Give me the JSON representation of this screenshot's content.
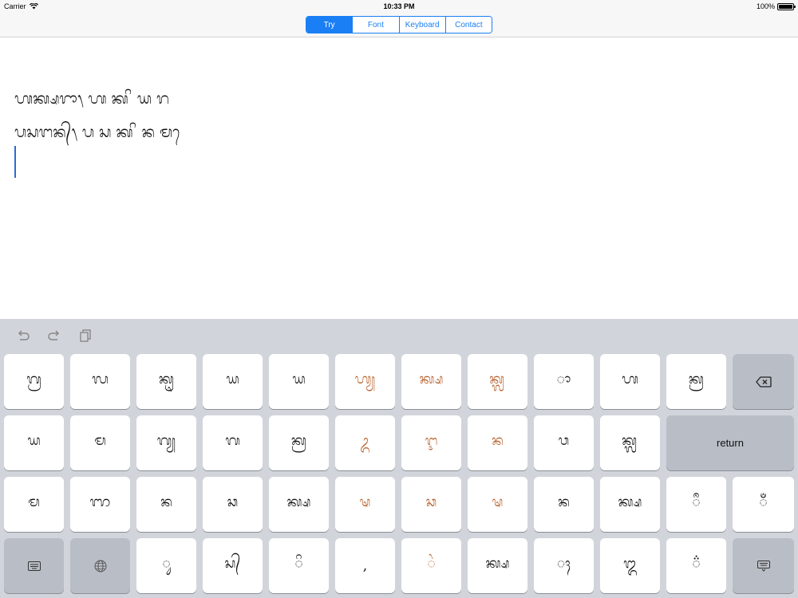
{
  "status_bar": {
    "carrier": "Carrier",
    "time": "10:33 PM",
    "battery": "100%"
  },
  "nav": {
    "segments": [
      {
        "label": "Try",
        "selected": true
      },
      {
        "label": "Font",
        "selected": false
      },
      {
        "label": "Keyboard",
        "selected": false
      },
      {
        "label": "Contact",
        "selected": false
      }
    ]
  },
  "editor": {
    "lines": [
      "ᬳᬓ᭄ᬱᬭᬵ᭞ ᬳ ᬓ ᬶ ᬬ ᬭ",
      "ᬧᬲᬗᬦ᭄᭞ ᬧ ᬲ ᬓ ᬶ ᬦ ᬫ ᬾ"
    ]
  },
  "keyboard": {
    "toolbar": {
      "undo_icon": "undo-icon",
      "redo_icon": "redo-icon",
      "paste_icon": "paste-icon"
    },
    "rows": [
      [
        "ᬕ᭄ᬭ",
        "ᬮ",
        "ᬓᬺ",
        "ᬬ",
        "ᬬ",
        "ᬳ᭄ᬬ",
        "ᬓ᭄ᬱ",
        "ᬓ᭄ᬮ",
        "ᬵ",
        "ᬳ",
        "ᬓ᭄ᬭ"
      ],
      [
        "ᬬ",
        "ᬫ",
        "ᬕ᭄ᬬ",
        "ᬕ",
        "ᬓ᭄ᬭ",
        "ᬉ",
        "ᬇ",
        "ᬦ",
        "ᬯ",
        "ᬓ᭄ᬮ"
      ],
      [
        "ᬫ",
        "ᬜ",
        "ᬦ",
        "ᬘ",
        "ᬓ᭄ᬱ",
        "ᬱ",
        "ᬘ",
        "ᬱ",
        "ᬦ",
        "ᬓ᭄ᬱ",
        "ᬷ",
        "ᬁ"
      ],
      [
        "ᬸ",
        "ᬲ᭄",
        "ᬶ",
        ",",
        "ᬂ",
        "ᬓ᭄ᬱ",
        "ᬄ",
        "᭓",
        "᬴"
      ]
    ],
    "backspace_icon": "backspace-icon",
    "return_label": "return",
    "keyboard_icon": "keyboard-icon",
    "globe_icon": "globe-icon",
    "hide_keyboard_icon": "hide-keyboard-icon"
  },
  "colors": {
    "accent": "#1a7ff5",
    "orange_key": "#b8602a",
    "keyboard_bg": "#d1d5db",
    "function_key": "#b9bec6",
    "caret": "#2d6ad8"
  }
}
